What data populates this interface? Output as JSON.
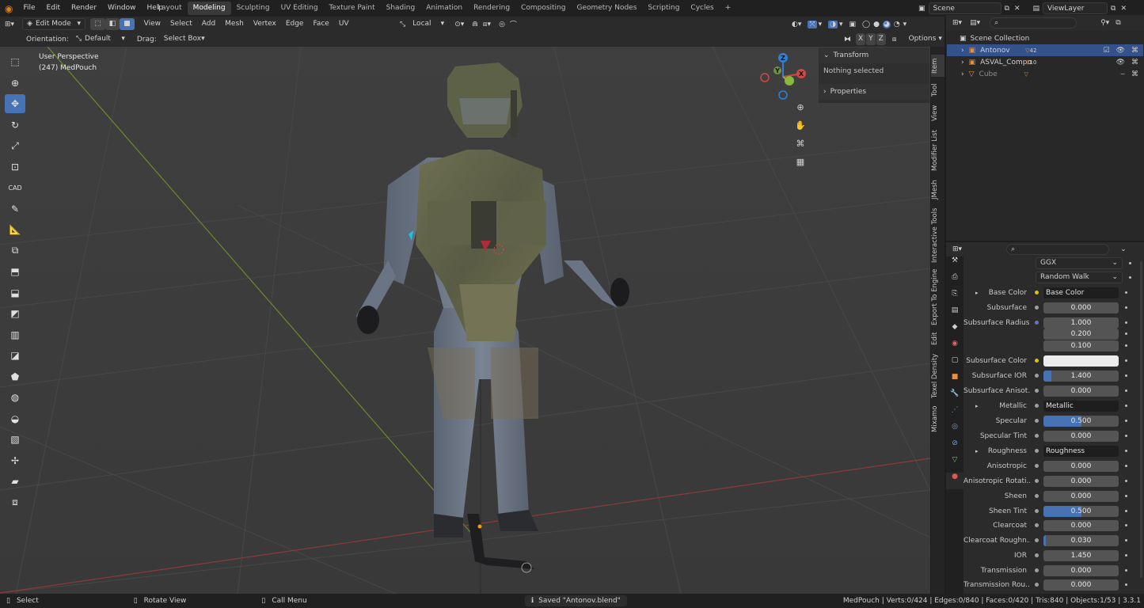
{
  "topbar": {
    "menus": [
      "File",
      "Edit",
      "Render",
      "Window",
      "Help"
    ],
    "workspaces": [
      "Layout",
      "Modeling",
      "Sculpting",
      "UV Editing",
      "Texture Paint",
      "Shading",
      "Animation",
      "Rendering",
      "Compositing",
      "Geometry Nodes",
      "Scripting",
      "Cycles"
    ],
    "active_workspace": "Modeling",
    "scene": "Scene",
    "view_layer": "ViewLayer"
  },
  "viewport_header": {
    "mode": "Edit Mode",
    "menus": [
      "View",
      "Select",
      "Add",
      "Mesh",
      "Vertex",
      "Edge",
      "Face",
      "UV"
    ],
    "transform_pivot": "Local",
    "orientation_label": "Orientation:",
    "orientation_value": "Default",
    "drag_label": "Drag:",
    "drag_value": "Select Box",
    "axes": [
      "X",
      "Y",
      "Z"
    ],
    "options": "Options"
  },
  "viewport": {
    "perspective": "User Perspective",
    "object_info": "(247) MedPouch",
    "gizmo": {
      "z": "Z",
      "y": "Y",
      "x": "X"
    }
  },
  "npanel": {
    "transform_title": "Transform",
    "nothing_selected": "Nothing selected",
    "properties_title": "Properties"
  },
  "side_tabs": [
    "Item",
    "Tool",
    "View",
    "Modifier List",
    "JMesh",
    "Interactive Tools",
    "Export To Engine",
    "Edit",
    "Texel Density",
    "Mixamo"
  ],
  "outliner": {
    "root": "Scene Collection",
    "items": [
      {
        "name": "Antonov",
        "badge": "42",
        "selected": true
      },
      {
        "name": "ASVAL_Compo",
        "badge": "10",
        "selected": false
      },
      {
        "name": "Cube",
        "badge": "",
        "selected": false
      }
    ]
  },
  "properties": {
    "distribution": "GGX",
    "subsurface_method": "Random Walk",
    "rows": [
      {
        "label": "Base Color",
        "type": "link",
        "value": "Base Color",
        "dot": "#e0c000",
        "expand": true
      },
      {
        "label": "Subsurface",
        "type": "num",
        "value": "0.000",
        "fill": 0
      },
      {
        "label": "Subsurface Radius",
        "type": "num",
        "value": "1.000",
        "fill": 0,
        "dot": "#6373c7"
      },
      {
        "label": "",
        "type": "num",
        "value": "0.200",
        "fill": 0,
        "nodot": true
      },
      {
        "label": "",
        "type": "num",
        "value": "0.100",
        "fill": 0,
        "nodot": true
      },
      {
        "label": "Subsurface Color",
        "type": "color",
        "value": "",
        "dot": "#e0c000"
      },
      {
        "label": "Subsurface IOR",
        "type": "num",
        "value": "1.400",
        "fill": 0.1
      },
      {
        "label": "Subsurface Anisot...",
        "type": "num",
        "value": "0.000",
        "fill": 0
      },
      {
        "label": "Metallic",
        "type": "link",
        "value": "Metallic",
        "expand": true
      },
      {
        "label": "Specular",
        "type": "num",
        "value": "0.500",
        "fill": 0.5
      },
      {
        "label": "Specular Tint",
        "type": "num",
        "value": "0.000",
        "fill": 0
      },
      {
        "label": "Roughness",
        "type": "link",
        "value": "Roughness",
        "expand": true
      },
      {
        "label": "Anisotropic",
        "type": "num",
        "value": "0.000",
        "fill": 0
      },
      {
        "label": "Anisotropic Rotati...",
        "type": "num",
        "value": "0.000",
        "fill": 0
      },
      {
        "label": "Sheen",
        "type": "num",
        "value": "0.000",
        "fill": 0
      },
      {
        "label": "Sheen Tint",
        "type": "num",
        "value": "0.500",
        "fill": 0.5
      },
      {
        "label": "Clearcoat",
        "type": "num",
        "value": "0.000",
        "fill": 0
      },
      {
        "label": "Clearcoat Roughn...",
        "type": "num",
        "value": "0.030",
        "fill": 0.03
      },
      {
        "label": "IOR",
        "type": "num",
        "value": "1.450",
        "fill": 0
      },
      {
        "label": "Transmission",
        "type": "num",
        "value": "0.000",
        "fill": 0
      },
      {
        "label": "Transmission Rou...",
        "type": "num",
        "value": "0.000",
        "fill": 0
      }
    ]
  },
  "statusbar": {
    "select": "Select",
    "rotate": "Rotate View",
    "call_menu": "Call Menu",
    "saved": "Saved \"Antonov.blend\"",
    "stats": "MedPouch | Verts:0/424 | Edges:0/840 | Faces:0/420 | Tris:840 | Objects:1/53 | 3.3.1"
  },
  "colors": {
    "accent": "#4772b3",
    "selected_row": "#33518a",
    "viewport_bg": "#3d3d3d",
    "axis_x": "#d44646",
    "axis_y": "#86b83a",
    "axis_z": "#2f7fd8"
  }
}
